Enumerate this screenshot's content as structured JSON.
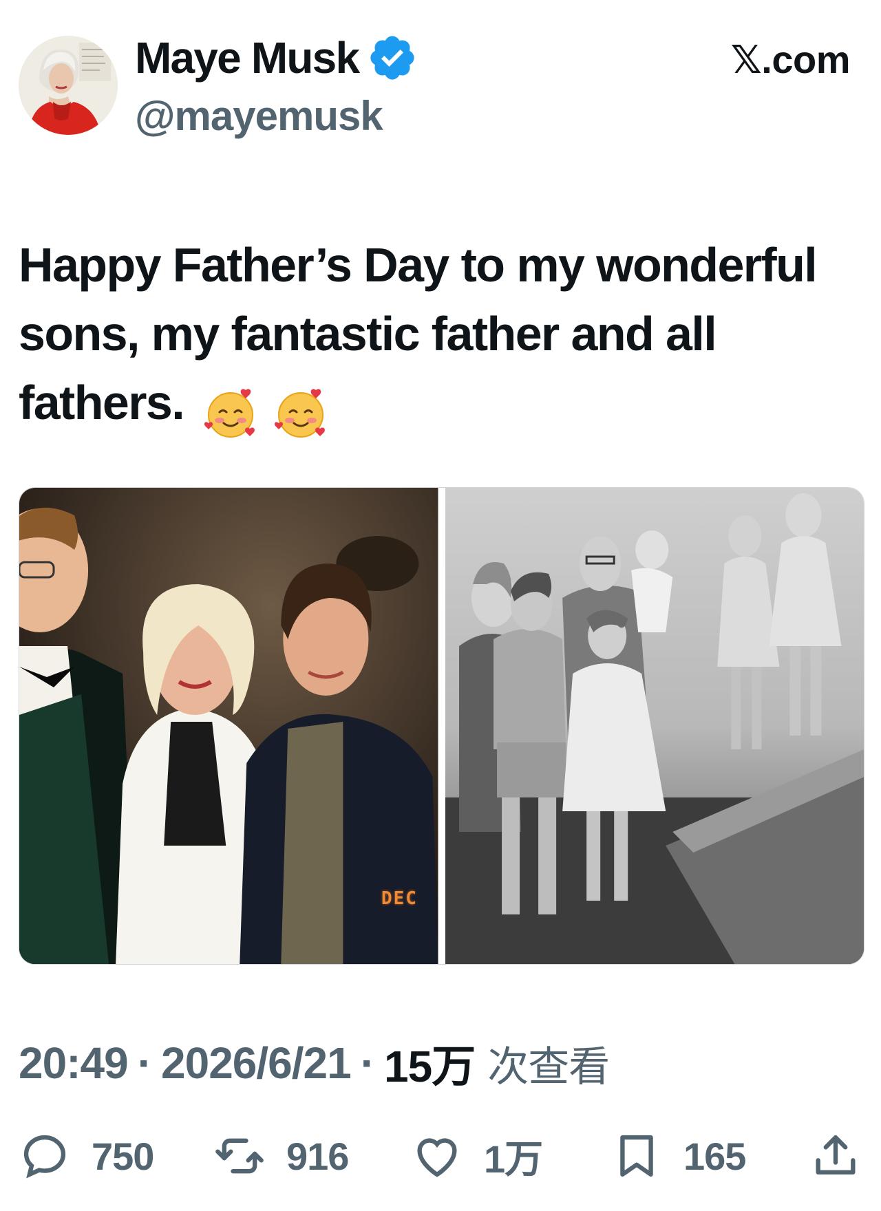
{
  "author": {
    "display_name": "Maye Musk",
    "handle": "@mayemusk",
    "verified": true,
    "avatar_icon": "profile-avatar-woman-red-jacket"
  },
  "source": "𝕏.com",
  "tweet": {
    "text": "Happy Father’s Day to my wonderful sons, my fantastic father and all fathers.",
    "emojis": [
      "smiling-face-with-hearts-icon",
      "smiling-face-with-hearts-icon"
    ]
  },
  "media": {
    "photo_1": {
      "stamp": "DEC"
    },
    "photo_2": {}
  },
  "meta": {
    "time": "20:49",
    "date": "2026/6/21",
    "views_count": "15万",
    "views_label": "次查看",
    "separator": "·"
  },
  "actions": {
    "reply": {
      "icon": "reply-icon",
      "count": "750"
    },
    "repost": {
      "icon": "repost-icon",
      "count": "916"
    },
    "like": {
      "icon": "like-icon",
      "count": "1万"
    },
    "bookmark": {
      "icon": "bookmark-icon",
      "count": "165"
    },
    "share": {
      "icon": "share-icon"
    }
  },
  "colors": {
    "primary_text": "#0f1419",
    "secondary_text": "#536471",
    "verified_blue": "#1d9bf0",
    "background": "#ffffff"
  }
}
